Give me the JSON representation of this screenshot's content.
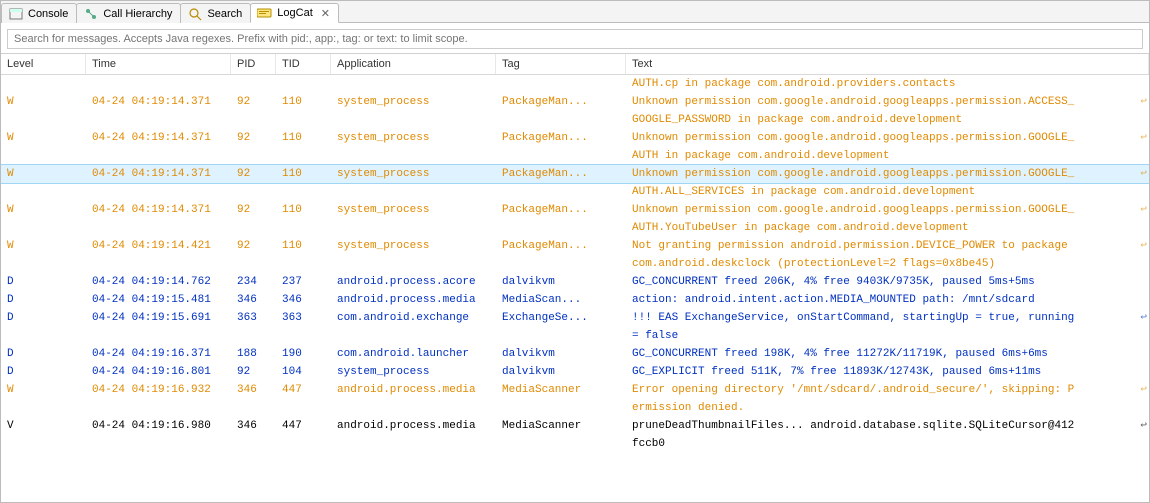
{
  "tabs": [
    {
      "label": "Console"
    },
    {
      "label": "Call Hierarchy"
    },
    {
      "label": "Search"
    },
    {
      "label": "LogCat"
    }
  ],
  "active_tab_index": 3,
  "search_placeholder": "Search for messages. Accepts Java regexes. Prefix with pid:, app:, tag: or text: to limit scope.",
  "columns": {
    "level": "Level",
    "time": "Time",
    "pid": "PID",
    "tid": "TID",
    "app": "Application",
    "tag": "Tag",
    "text": "Text"
  },
  "selected_row": 5,
  "rows": [
    {
      "level": "",
      "time": "",
      "pid": "",
      "tid": "",
      "app": "",
      "tag": "",
      "text": "AUTH.cp in package com.android.providers.contacts",
      "cls": "W"
    },
    {
      "level": "W",
      "time": "04-24 04:19:14.371",
      "pid": "92",
      "tid": "110",
      "app": "system_process",
      "tag": "PackageMan...",
      "text": "Unknown permission com.google.android.googleapps.permission.ACCESS_",
      "cls": "W",
      "wrap": true
    },
    {
      "level": "",
      "time": "",
      "pid": "",
      "tid": "",
      "app": "",
      "tag": "",
      "text": "GOOGLE_PASSWORD in package com.android.development",
      "cls": "W"
    },
    {
      "level": "W",
      "time": "04-24 04:19:14.371",
      "pid": "92",
      "tid": "110",
      "app": "system_process",
      "tag": "PackageMan...",
      "text": "Unknown permission com.google.android.googleapps.permission.GOOGLE_",
      "cls": "W",
      "wrap": true
    },
    {
      "level": "",
      "time": "",
      "pid": "",
      "tid": "",
      "app": "",
      "tag": "",
      "text": "AUTH in package com.android.development",
      "cls": "W"
    },
    {
      "level": "W",
      "time": "04-24 04:19:14.371",
      "pid": "92",
      "tid": "110",
      "app": "system_process",
      "tag": "PackageMan...",
      "text": "Unknown permission com.google.android.googleapps.permission.GOOGLE_",
      "cls": "W",
      "wrap": true
    },
    {
      "level": "",
      "time": "",
      "pid": "",
      "tid": "",
      "app": "",
      "tag": "",
      "text": "AUTH.ALL_SERVICES in package com.android.development",
      "cls": "W"
    },
    {
      "level": "W",
      "time": "04-24 04:19:14.371",
      "pid": "92",
      "tid": "110",
      "app": "system_process",
      "tag": "PackageMan...",
      "text": "Unknown permission com.google.android.googleapps.permission.GOOGLE_",
      "cls": "W",
      "wrap": true
    },
    {
      "level": "",
      "time": "",
      "pid": "",
      "tid": "",
      "app": "",
      "tag": "",
      "text": "AUTH.YouTubeUser in package com.android.development",
      "cls": "W"
    },
    {
      "level": "W",
      "time": "04-24 04:19:14.421",
      "pid": "92",
      "tid": "110",
      "app": "system_process",
      "tag": "PackageMan...",
      "text": "Not granting permission android.permission.DEVICE_POWER to package",
      "cls": "W",
      "wrap": true
    },
    {
      "level": "",
      "time": "",
      "pid": "",
      "tid": "",
      "app": "",
      "tag": "",
      "text": "com.android.deskclock (protectionLevel=2 flags=0x8be45)",
      "cls": "W"
    },
    {
      "level": "D",
      "time": "04-24 04:19:14.762",
      "pid": "234",
      "tid": "237",
      "app": "android.process.acore",
      "tag": "dalvikvm",
      "text": "GC_CONCURRENT freed 206K, 4% free 9403K/9735K, paused 5ms+5ms",
      "cls": "D"
    },
    {
      "level": "D",
      "time": "04-24 04:19:15.481",
      "pid": "346",
      "tid": "346",
      "app": "android.process.media",
      "tag": "MediaScan...",
      "text": "action: android.intent.action.MEDIA_MOUNTED path: /mnt/sdcard",
      "cls": "D"
    },
    {
      "level": "D",
      "time": "04-24 04:19:15.691",
      "pid": "363",
      "tid": "363",
      "app": "com.android.exchange",
      "tag": "ExchangeSe...",
      "text": "!!! EAS ExchangeService, onStartCommand, startingUp = true, running",
      "cls": "D",
      "wrap": true
    },
    {
      "level": "",
      "time": "",
      "pid": "",
      "tid": "",
      "app": "",
      "tag": "",
      "text": " = false",
      "cls": "D"
    },
    {
      "level": "D",
      "time": "04-24 04:19:16.371",
      "pid": "188",
      "tid": "190",
      "app": "com.android.launcher",
      "tag": "dalvikvm",
      "text": "GC_CONCURRENT freed 198K, 4% free 11272K/11719K, paused 6ms+6ms",
      "cls": "D"
    },
    {
      "level": "D",
      "time": "04-24 04:19:16.801",
      "pid": "92",
      "tid": "104",
      "app": "system_process",
      "tag": "dalvikvm",
      "text": "GC_EXPLICIT freed 511K, 7% free 11893K/12743K, paused 6ms+11ms",
      "cls": "D"
    },
    {
      "level": "W",
      "time": "04-24 04:19:16.932",
      "pid": "346",
      "tid": "447",
      "app": "android.process.media",
      "tag": "MediaScanner",
      "text": "Error opening directory '/mnt/sdcard/.android_secure/', skipping: P",
      "cls": "W",
      "wrap": true
    },
    {
      "level": "",
      "time": "",
      "pid": "",
      "tid": "",
      "app": "",
      "tag": "",
      "text": "ermission denied.",
      "cls": "W"
    },
    {
      "level": "V",
      "time": "04-24 04:19:16.980",
      "pid": "346",
      "tid": "447",
      "app": "android.process.media",
      "tag": "MediaScanner",
      "text": "pruneDeadThumbnailFiles... android.database.sqlite.SQLiteCursor@412",
      "cls": "V",
      "wrap": true
    },
    {
      "level": "",
      "time": "",
      "pid": "",
      "tid": "",
      "app": "",
      "tag": "",
      "text": "fccb0",
      "cls": "V"
    }
  ]
}
